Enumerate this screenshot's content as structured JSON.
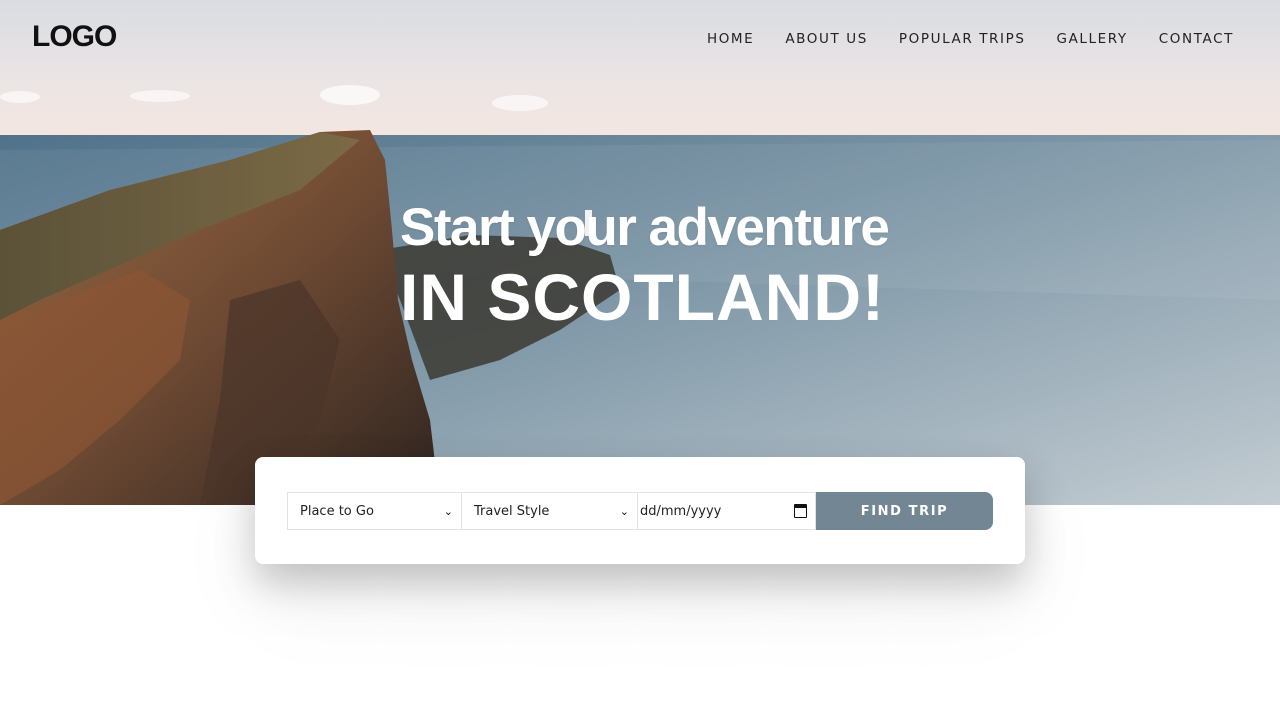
{
  "header": {
    "logo": "LOGO",
    "nav": [
      "HOME",
      "ABOUT US",
      "POPULAR TRIPS",
      "GALLERY",
      "CONTACT"
    ]
  },
  "hero": {
    "line1": "Start your adventure",
    "line2": "IN SCOTLAND!"
  },
  "search": {
    "place_select": "Place to Go",
    "style_select": "Travel Style",
    "date_placeholder": "dd/mm/yyyy",
    "button": "FIND TRIP"
  },
  "colors": {
    "button": "#738694",
    "text": "#222222"
  }
}
